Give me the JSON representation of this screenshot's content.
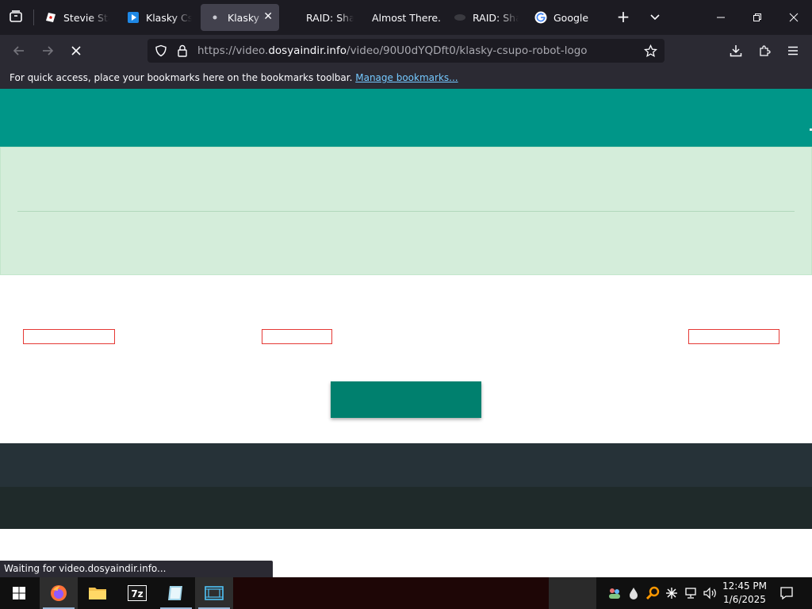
{
  "tabs": [
    {
      "label": "Stevie Stan",
      "favicon": "roblox-icon"
    },
    {
      "label": "Klasky Csu",
      "favicon": "video-play-icon"
    },
    {
      "label": "Klasky C",
      "favicon": "loading-dot-icon"
    },
    {
      "label": "RAID: Shad",
      "favicon": "none"
    },
    {
      "label": "Almost There...",
      "favicon": "none"
    },
    {
      "label": "RAID: Shad",
      "favicon": "raid-icon"
    },
    {
      "label": "Google",
      "favicon": "google-icon"
    }
  ],
  "url": {
    "scheme": "https://video.",
    "host": "dosyaindir.info",
    "path": "/video/90U0dYQDft0/klasky-csupo-robot-logo"
  },
  "bookmarks_bar": {
    "message": "For quick access, place your bookmarks here on the bookmarks toolbar.",
    "link": "Manage bookmarks..."
  },
  "status_text": "Waiting for video.dosyaindir.info...",
  "clock": {
    "time": "12:45 PM",
    "date": "1/6/2025"
  },
  "colors": {
    "header": "#009688",
    "banner": "#d4edda",
    "download_button": "#00806e",
    "footer_top": "#263238",
    "footer_bottom": "#1f2a2a"
  }
}
